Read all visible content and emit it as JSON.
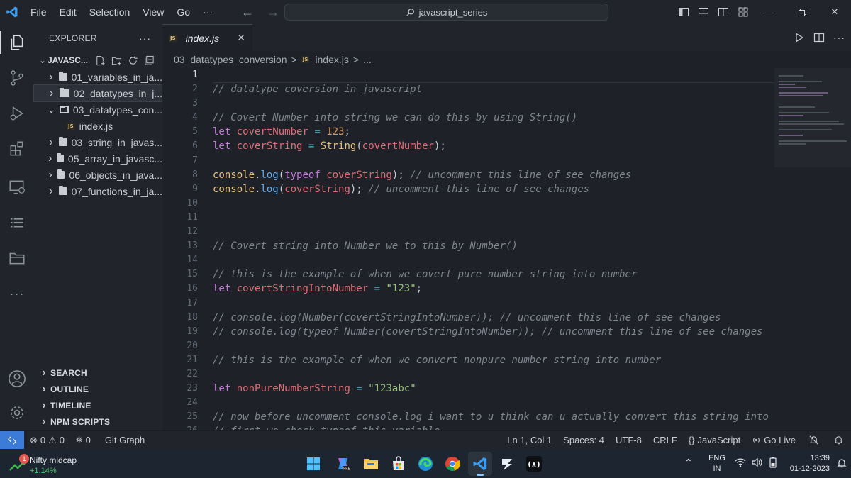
{
  "menu": {
    "items": [
      "File",
      "Edit",
      "Selection",
      "View",
      "Go",
      "···"
    ]
  },
  "search": {
    "text": "javascript_series"
  },
  "explorer": {
    "title": "EXPLORER",
    "more": "···",
    "root": "JAVASC...",
    "items": [
      {
        "label": "01_variables_in_ja...",
        "type": "folder",
        "expanded": false
      },
      {
        "label": "02_datatypes_in_j...",
        "type": "folder",
        "expanded": false,
        "selected": true
      },
      {
        "label": "03_datatypes_con...",
        "type": "folder",
        "expanded": true
      },
      {
        "label": "index.js",
        "type": "file"
      },
      {
        "label": "03_string_in_javas...",
        "type": "folder",
        "expanded": false
      },
      {
        "label": "05_array_in_javasc...",
        "type": "folder",
        "expanded": false
      },
      {
        "label": "06_objects_in_java...",
        "type": "folder",
        "expanded": false
      },
      {
        "label": "07_functions_in_ja...",
        "type": "folder",
        "expanded": false
      }
    ],
    "sections": [
      "SEARCH",
      "OUTLINE",
      "TIMELINE",
      "NPM SCRIPTS"
    ]
  },
  "tab": {
    "label": "index.js",
    "badge": "JS",
    "close": "✕"
  },
  "breadcrumb": {
    "folder": "03_datatypes_conversion",
    "file": "index.js",
    "sep": ">",
    "more": "..."
  },
  "editor": {
    "current_line": 1,
    "lines": [
      {
        "n": "1",
        "text": ""
      },
      {
        "n": "2",
        "text": "// datatype coversion in javascript"
      },
      {
        "n": "3",
        "text": ""
      },
      {
        "n": "4",
        "text": "// Covert Number into string we can do this by using String()"
      },
      {
        "n": "5",
        "text": "let covertNumber = 123;"
      },
      {
        "n": "6",
        "text": "let coverString = String(covertNumber);"
      },
      {
        "n": "7",
        "text": ""
      },
      {
        "n": "8",
        "text": "console.log(typeof coverString); // uncomment this line of see changes"
      },
      {
        "n": "9",
        "text": "console.log(coverString); // uncomment this line of see changes"
      },
      {
        "n": "10",
        "text": ""
      },
      {
        "n": "11",
        "text": ""
      },
      {
        "n": "12",
        "text": ""
      },
      {
        "n": "13",
        "text": "// Covert string into Number we to this by Number()"
      },
      {
        "n": "14",
        "text": ""
      },
      {
        "n": "15",
        "text": "// this is the example of when we covert pure number string into number"
      },
      {
        "n": "16",
        "text": "let covertStringIntoNumber = \"123\";"
      },
      {
        "n": "17",
        "text": ""
      },
      {
        "n": "18",
        "text": "// console.log(Number(covertStringIntoNumber)); // uncomment this line of see changes"
      },
      {
        "n": "19",
        "text": "// console.log(typeof Number(covertStringIntoNumber)); // uncomment this line of see changes"
      },
      {
        "n": "20",
        "text": ""
      },
      {
        "n": "21",
        "text": "// this is the example of when we convert nonpure number string into number"
      },
      {
        "n": "22",
        "text": ""
      },
      {
        "n": "23",
        "text": "let nonPureNumberString = \"123abc\""
      },
      {
        "n": "24",
        "text": ""
      },
      {
        "n": "25",
        "text": "// now before uncomment console.log i want to u think can u actually convert this string into number"
      },
      {
        "n": "26",
        "text": "// first we check typeof this variable"
      }
    ]
  },
  "statusbar": {
    "errors": "0",
    "warnings": "0",
    "ports": "0",
    "git_graph": "Git Graph",
    "position": "Ln 1, Col 1",
    "spaces": "Spaces: 4",
    "encoding": "UTF-8",
    "eol": "CRLF",
    "language_braces": "{}",
    "language": "JavaScript",
    "go_live": "Go Live"
  },
  "taskbar": {
    "widget_title": "Nifty midcap",
    "widget_value": "+1.14%",
    "widget_badge": "1",
    "lang_top": "ENG",
    "lang_bottom": "IN",
    "time": "13:39",
    "date": "01-12-2023"
  },
  "colors": {
    "accent": "#3d7bd9",
    "background": "#1e2128",
    "chrome": "#21252b"
  }
}
